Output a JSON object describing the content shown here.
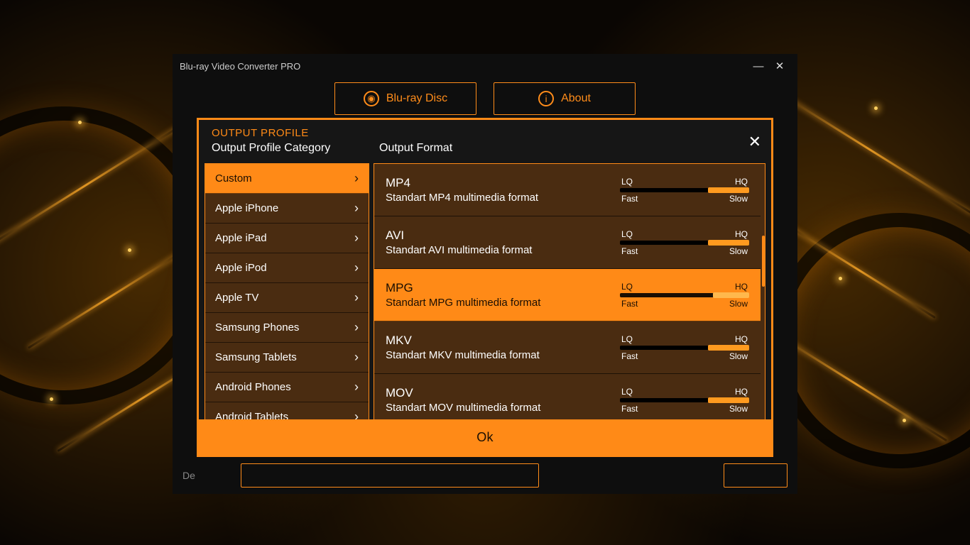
{
  "window": {
    "title": "Blu-ray Video Converter PRO",
    "toolbar": {
      "bluray": "Blu-ray Disc",
      "about": "About"
    },
    "bottom_prefix": "De"
  },
  "modal": {
    "title": "OUTPUT PROFILE",
    "category_label": "Output Profile Category",
    "format_label": "Output Format",
    "ok": "Ok",
    "slider": {
      "lq": "LQ",
      "hq": "HQ",
      "fast": "Fast",
      "slow": "Slow"
    },
    "categories": [
      {
        "label": "Custom",
        "selected": true
      },
      {
        "label": "Apple iPhone",
        "selected": false
      },
      {
        "label": "Apple iPad",
        "selected": false
      },
      {
        "label": "Apple iPod",
        "selected": false
      },
      {
        "label": "Apple TV",
        "selected": false
      },
      {
        "label": "Samsung Phones",
        "selected": false
      },
      {
        "label": "Samsung Tablets",
        "selected": false
      },
      {
        "label": "Android Phones",
        "selected": false
      },
      {
        "label": "Android Tablets",
        "selected": false
      }
    ],
    "formats": [
      {
        "name": "MP4",
        "desc": "Standart MP4 multimedia format",
        "selected": false,
        "fill_pct": 32
      },
      {
        "name": "AVI",
        "desc": "Standart AVI multimedia format",
        "selected": false,
        "fill_pct": 32
      },
      {
        "name": "MPG",
        "desc": "Standart MPG multimedia format",
        "selected": true,
        "fill_pct": 28
      },
      {
        "name": "MKV",
        "desc": "Standart MKV multimedia format",
        "selected": false,
        "fill_pct": 32
      },
      {
        "name": "MOV",
        "desc": "Standart MOV multimedia format",
        "selected": false,
        "fill_pct": 32
      }
    ],
    "scrollbar": {
      "thumb_top_pct": 28,
      "thumb_height_pct": 20
    }
  }
}
